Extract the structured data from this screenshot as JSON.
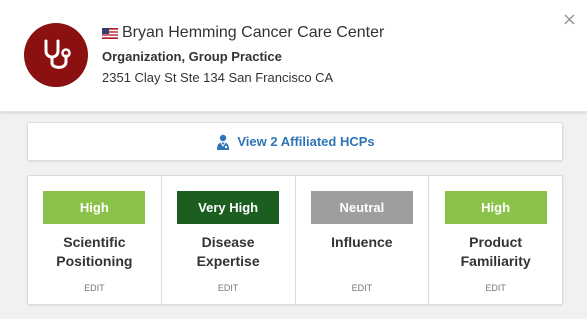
{
  "header": {
    "name": "Bryan Hemming Cancer Care Center",
    "org_type": "Organization, Group Practice",
    "address": "2351 Clay St Ste 134 San Francisco CA",
    "close_glyph": "×",
    "avatar_color": "#8b1111",
    "avatar_icon": "stethoscope-icon",
    "flag_icon": "us-flag-icon"
  },
  "affiliated": {
    "label": "View 2 Affiliated HCPs",
    "icon": "doctor-icon",
    "color": "#2f74b5"
  },
  "metrics": [
    {
      "badge": "High",
      "badge_color": "#8bc34a",
      "label_line1": "Scientific",
      "label_line2": "Positioning",
      "edit": "EDIT"
    },
    {
      "badge": "Very High",
      "badge_color": "#1b5e20",
      "label_line1": "Disease",
      "label_line2": "Expertise",
      "edit": "EDIT"
    },
    {
      "badge": "Neutral",
      "badge_color": "#9e9e9e",
      "label_line1": "Influence",
      "label_line2": "",
      "edit": "EDIT"
    },
    {
      "badge": "High",
      "badge_color": "#8bc34a",
      "label_line1": "Product",
      "label_line2": "Familiarity",
      "edit": "EDIT"
    }
  ]
}
